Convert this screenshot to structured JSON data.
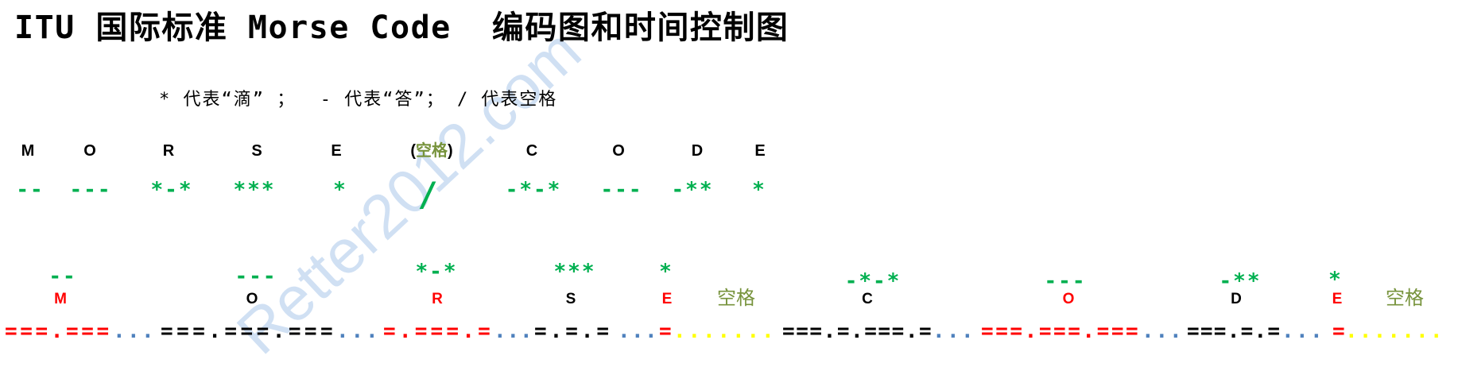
{
  "title": "ITU 国际标准 Morse Code  编码图和时间控制图",
  "legend": "* 代表“滴” ；  - 代表“答”； / 代表空格",
  "watermark": "Retter2012.com",
  "palette": {
    "code": "#00B050",
    "space_label": "#77933C",
    "watermark": "#C5D9F1"
  },
  "encoding": {
    "items": [
      {
        "letter": "M",
        "code": "--"
      },
      {
        "letter": "O",
        "code": "---"
      },
      {
        "letter": "R",
        "code": "*-*"
      },
      {
        "letter": "S",
        "code": "***"
      },
      {
        "letter": "E",
        "code": "*"
      },
      {
        "open": "(",
        "letter": "空格",
        "close": ")",
        "code": "/"
      },
      {
        "letter": "C",
        "code": "-*-*"
      },
      {
        "letter": "O",
        "code": "---"
      },
      {
        "letter": "D",
        "code": "-**"
      },
      {
        "letter": "E",
        "code": "*"
      }
    ]
  },
  "timing": {
    "labels": [
      {
        "code": "--",
        "letter": "M",
        "color": "#FF0000"
      },
      {
        "code": "---",
        "letter": "O",
        "color": "#000000"
      },
      {
        "code": "*-*",
        "letter": "R",
        "color": "#FF0000"
      },
      {
        "code": "***",
        "letter": "S",
        "color": "#000000"
      },
      {
        "code": "*",
        "letter": "E",
        "color": "#FF0000"
      },
      {
        "letter": "空格",
        "color": "#77933C"
      },
      {
        "code": "-*-*",
        "letter": "C",
        "color": "#000000"
      },
      {
        "code": "---",
        "letter": "O",
        "color": "#FF0000"
      },
      {
        "code": "-**",
        "letter": "D",
        "color": "#000000"
      },
      {
        "code": "*",
        "letter": "E",
        "color": "#FF0000"
      },
      {
        "letter": "空格",
        "color": "#77933C"
      }
    ],
    "line": [
      {
        "text": "===.===",
        "color": "#FF0000"
      },
      {
        "text": "...",
        "color": "#4F81BD"
      },
      {
        "text": "===.===.===",
        "color": "#000000"
      },
      {
        "text": "...",
        "color": "#4F81BD"
      },
      {
        "text": "=.===.=",
        "color": "#FF0000"
      },
      {
        "text": "...",
        "color": "#4F81BD"
      },
      {
        "text": "=.=.=",
        "color": "#000000"
      },
      {
        "text": "...",
        "color": "#4F81BD"
      },
      {
        "text": "=",
        "color": "#FF0000"
      },
      {
        "text": ".......",
        "color": "#FFFF00"
      },
      {
        "text": "===.=.===.=",
        "color": "#000000"
      },
      {
        "text": "...",
        "color": "#4F81BD"
      },
      {
        "text": "===.===.===",
        "color": "#FF0000"
      },
      {
        "text": "...",
        "color": "#4F81BD"
      },
      {
        "text": "===.=.=",
        "color": "#000000"
      },
      {
        "text": "...",
        "color": "#4F81BD"
      },
      {
        "text": "=",
        "color": "#FF0000"
      },
      {
        "text": ".......",
        "color": "#FFFF00"
      }
    ]
  }
}
